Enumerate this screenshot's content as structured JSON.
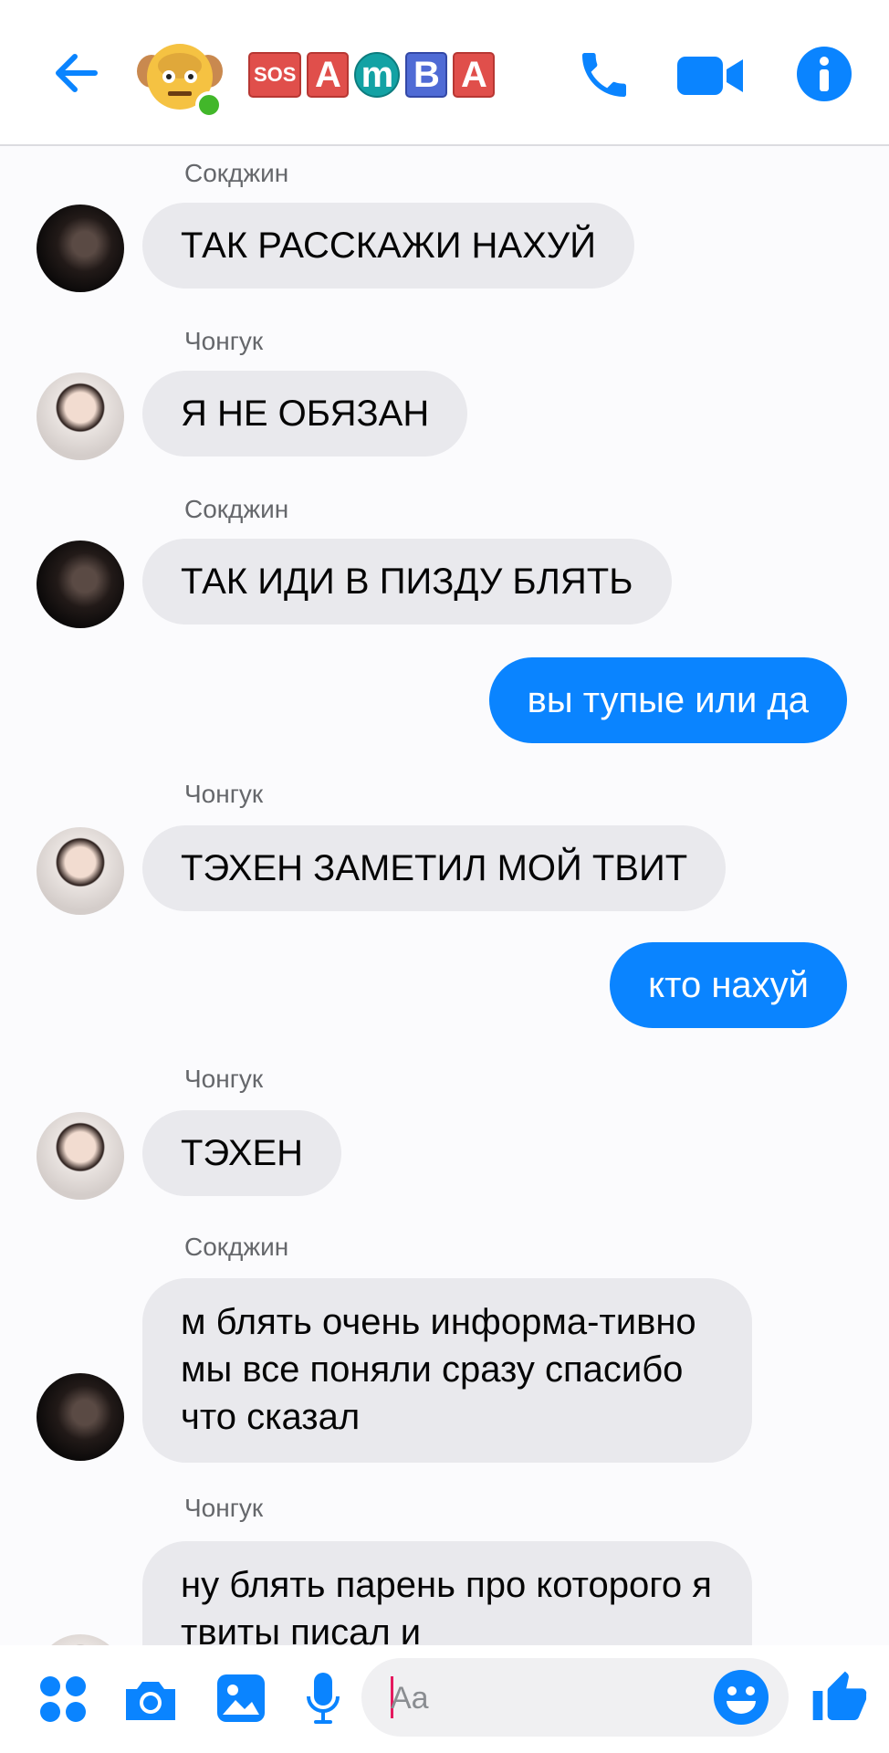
{
  "header": {
    "title_tiles": [
      "SOS",
      "A",
      "m",
      "B",
      "A"
    ],
    "icons": [
      "back-arrow-icon",
      "phone-icon",
      "video-camera-icon",
      "info-icon"
    ]
  },
  "messages": [
    {
      "sender": "Сокджин",
      "avatar": "jin",
      "text": "ТАК РАССКАЖИ НАХУЙ",
      "mine": false
    },
    {
      "sender": "Чонгук",
      "avatar": "jk",
      "text": "Я НЕ ОБЯЗАН",
      "mine": false
    },
    {
      "sender": "Сокджин",
      "avatar": "jin",
      "text": "ТАК ИДИ В ПИЗДУ БЛЯТЬ",
      "mine": false
    },
    {
      "sender": "",
      "avatar": "",
      "text": "вы тупые или да",
      "mine": true
    },
    {
      "sender": "Чонгук",
      "avatar": "jk",
      "text": "ТЭХЕН ЗАМЕТИЛ МОЙ ТВИТ",
      "mine": false
    },
    {
      "sender": "",
      "avatar": "",
      "text": "кто нахуй",
      "mine": true
    },
    {
      "sender": "Чонгук",
      "avatar": "jk",
      "text": "ТЭХЕН",
      "mine": false
    },
    {
      "sender": "Сокджин",
      "avatar": "jin",
      "text": "м блять очень информа-тивно мы все поняли сразу спасибо что сказал",
      "mine": false
    },
    {
      "sender": "Чонгук",
      "avatar": "jk",
      "text": "ну блять парень про которого я твиты писал и",
      "mine": false
    }
  ],
  "composer": {
    "placeholder": "Aa"
  },
  "colors": {
    "accent": "#0a84ff",
    "bubble_other": "#e9e9ed",
    "online": "#42b72a"
  }
}
